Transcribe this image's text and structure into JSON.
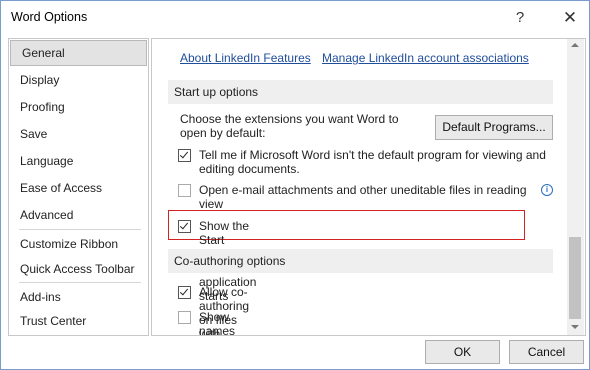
{
  "window": {
    "title": "Word Options",
    "help_label": "?",
    "close_label": "✕"
  },
  "nav": {
    "items": [
      {
        "label": "General",
        "selected": true
      },
      {
        "label": "Display"
      },
      {
        "label": "Proofing"
      },
      {
        "label": "Save"
      },
      {
        "label": "Language"
      },
      {
        "label": "Ease of Access"
      },
      {
        "label": "Advanced"
      },
      {
        "label": "Customize Ribbon"
      },
      {
        "label": "Quick Access Toolbar"
      },
      {
        "label": "Add-ins"
      },
      {
        "label": "Trust Center"
      }
    ]
  },
  "content": {
    "links": {
      "linkedin_features": "About LinkedIn Features",
      "manage_linkedin": "Manage LinkedIn account associations"
    },
    "startup": {
      "header": "Start up options",
      "description": "Choose the extensions you want Word to open by default:",
      "default_programs_button": "Default Programs...",
      "options": [
        {
          "label": "Tell me if Microsoft Word isn't the default program for viewing and editing documents.",
          "checked": true
        },
        {
          "label": "Open e-mail attachments and other uneditable files in reading view",
          "checked": false
        },
        {
          "label": "Show the Start screen when this application starts",
          "checked": true
        }
      ]
    },
    "coauthoring": {
      "header": "Co-authoring options",
      "options": [
        {
          "label": "Allow co-authoring on files with macros",
          "checked": true
        },
        {
          "label": "Show names on presence flags",
          "checked": false
        }
      ]
    }
  },
  "footer": {
    "ok_label": "OK",
    "cancel_label": "Cancel"
  },
  "colors": {
    "link": "#1f4e9a",
    "highlight_border": "#d12323",
    "section_bg": "#efefef",
    "selected_nav_bg": "#e3e3e3"
  },
  "icons": {
    "info": "info-icon",
    "checkbox": "checkbox"
  }
}
